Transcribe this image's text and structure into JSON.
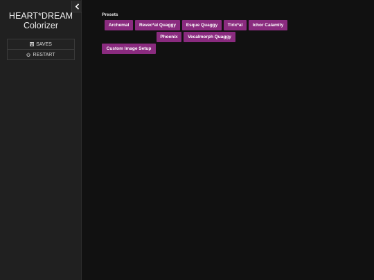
{
  "app": {
    "title_line1": "HEART*DREAM",
    "title_line2": "Colorizer"
  },
  "sidebar": {
    "collapse_icon": "chevron-left-icon",
    "items": [
      {
        "label": "SAVES",
        "icon": "save-icon"
      },
      {
        "label": "RESTART",
        "icon": "power-icon"
      }
    ]
  },
  "presets": {
    "heading": "Presets",
    "buttons": [
      "Archemal",
      "Revec*al Quaggy",
      "Esque Quaggy",
      "Tirix*al",
      "Ichor Calamity",
      "Phoenix",
      "Vecalmorph Quaggy"
    ],
    "custom_label": "Custom Image Setup"
  },
  "colors": {
    "background": "#111111",
    "sidebar": "#202020",
    "accent": "#8a2b7f"
  }
}
